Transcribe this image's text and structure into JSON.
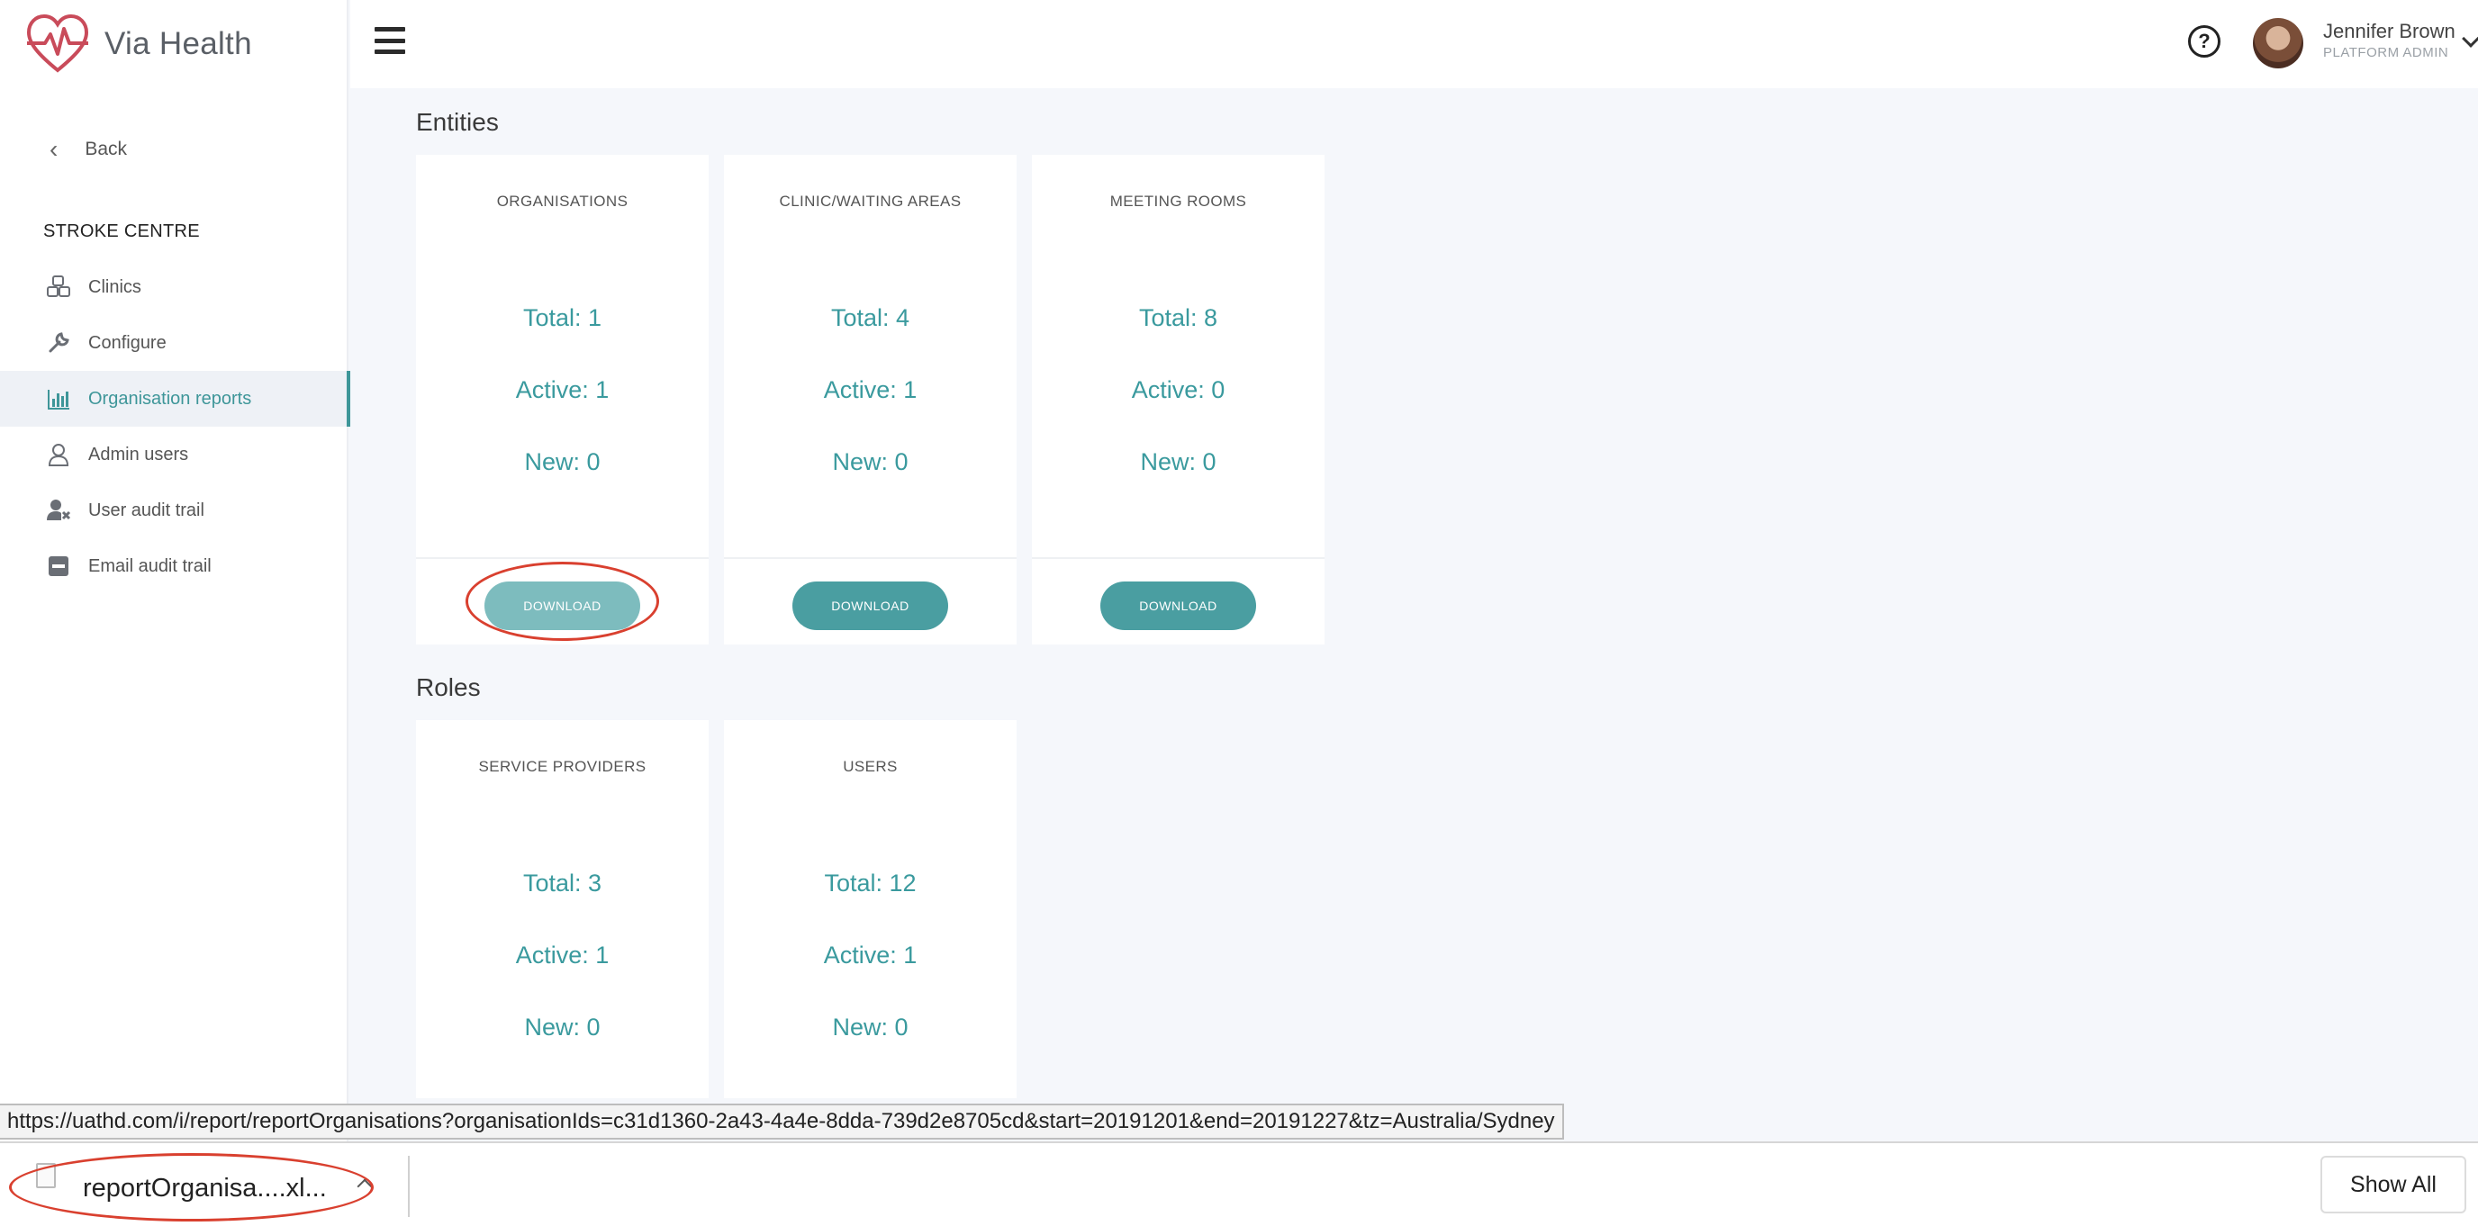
{
  "brand": {
    "name": "Via Health",
    "accent": "#3e9699",
    "logo_color": "#c94b5a"
  },
  "sidebar": {
    "back_label": "Back",
    "section_title": "STROKE CENTRE",
    "items": [
      {
        "label": "Clinics",
        "icon": "cubes-icon"
      },
      {
        "label": "Configure",
        "icon": "wrench-icon"
      },
      {
        "label": "Organisation reports",
        "icon": "bar-chart-icon",
        "active": true
      },
      {
        "label": "Admin users",
        "icon": "user-icon"
      },
      {
        "label": "User audit trail",
        "icon": "user-x-icon"
      },
      {
        "label": "Email audit trail",
        "icon": "minus-square-icon"
      }
    ]
  },
  "header": {
    "help_symbol": "?",
    "user_name": "Jennifer Brown",
    "user_role": "PLATFORM ADMIN"
  },
  "entities": {
    "heading": "Entities",
    "cards": [
      {
        "title": "ORGANISATIONS",
        "total": "Total: 1",
        "active": "Active: 1",
        "new": "New: 0",
        "download": "DOWNLOAD"
      },
      {
        "title": "CLINIC/WAITING AREAS",
        "total": "Total: 4",
        "active": "Active: 1",
        "new": "New: 0",
        "download": "DOWNLOAD"
      },
      {
        "title": "MEETING ROOMS",
        "total": "Total: 8",
        "active": "Active: 0",
        "new": "New: 0",
        "download": "DOWNLOAD"
      }
    ]
  },
  "roles": {
    "heading": "Roles",
    "cards": [
      {
        "title": "SERVICE PROVIDERS",
        "total": "Total: 3",
        "active": "Active: 1",
        "new": "New: 0"
      },
      {
        "title": "USERS",
        "total": "Total: 12",
        "active": "Active: 1",
        "new": "New: 0"
      }
    ]
  },
  "status_url": "https://uathd.com/i/report/reportOrganisations?organisationIds=c31d1360-2a43-4a4e-8dda-739d2e8705cd&start=20191201&end=20191227&tz=Australia/Sydney",
  "download_bar": {
    "file_name": "reportOrganisa....xl...",
    "show_all": "Show All"
  }
}
